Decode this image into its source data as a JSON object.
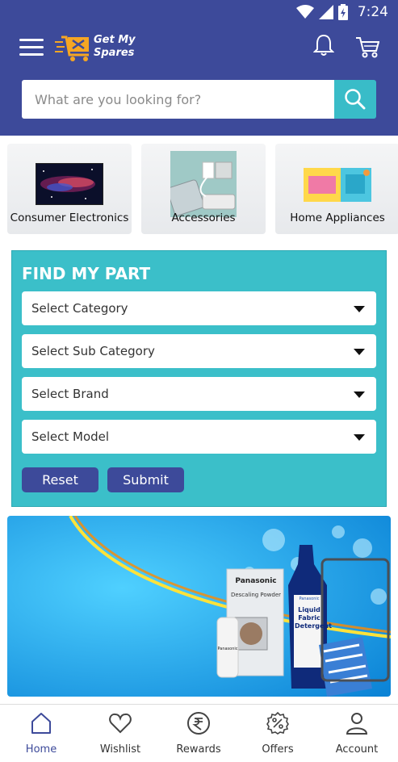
{
  "status_bar": {
    "time": "7:24"
  },
  "header": {
    "logo_line1": "Get My",
    "logo_line2": "Spares",
    "menu_icon": "hamburger-icon",
    "notification_icon": "bell-icon",
    "cart_icon": "cart-icon"
  },
  "search": {
    "placeholder": "What are you looking for?",
    "value": "",
    "icon": "search-icon"
  },
  "categories": [
    {
      "label": "Consumer Electronics"
    },
    {
      "label": "Accessories"
    },
    {
      "label": "Home Appliances"
    }
  ],
  "find_my_part": {
    "title": "FIND MY PART",
    "selects": [
      {
        "label": "Select Category"
      },
      {
        "label": "Select Sub Category"
      },
      {
        "label": "Select Brand"
      },
      {
        "label": "Select Model"
      }
    ],
    "reset_label": "Reset",
    "submit_label": "Submit"
  },
  "banner": {
    "brand_box": "Panasonic",
    "box_text": "Descaling Powder",
    "bottle_brand": "Panasonic",
    "bottle_text": "Liquid Fabric Detergent",
    "small_bottle": "Panasonic"
  },
  "bottom_nav": [
    {
      "label": "Home",
      "icon": "home-icon",
      "active": true
    },
    {
      "label": "Wishlist",
      "icon": "heart-icon",
      "active": false
    },
    {
      "label": "Rewards",
      "icon": "rupee-icon",
      "active": false
    },
    {
      "label": "Offers",
      "icon": "percent-icon",
      "active": false
    },
    {
      "label": "Account",
      "icon": "user-icon",
      "active": false
    }
  ],
  "colors": {
    "primary": "#3d4a9a",
    "accent": "#3bbfc9"
  }
}
